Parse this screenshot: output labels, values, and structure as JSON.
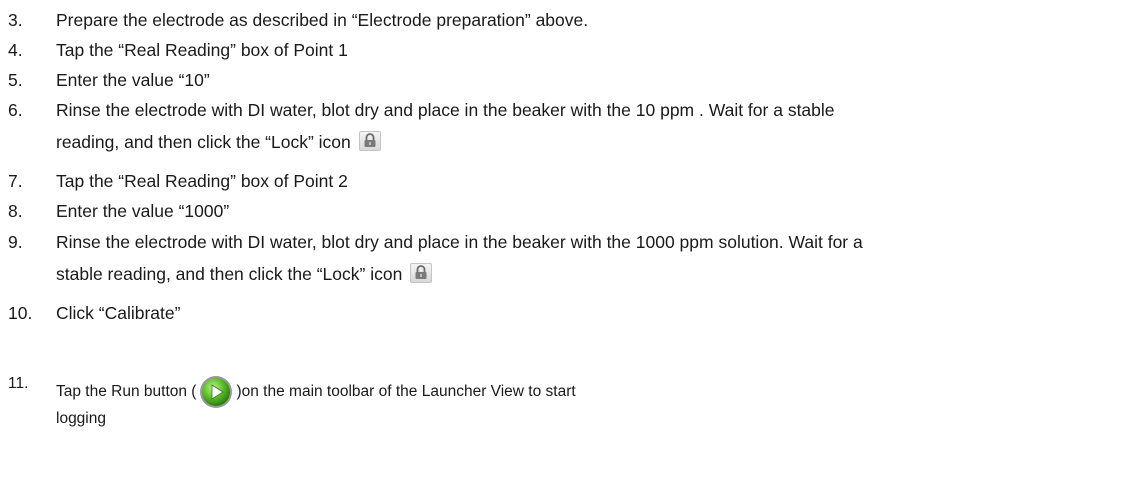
{
  "steps": [
    {
      "number": "3.",
      "text": "Prepare the electrode as described in “Electrode preparation” above."
    },
    {
      "number": "4.",
      "text": "Tap the “Real Reading” box of Point 1"
    },
    {
      "number": "5.",
      "text": "Enter the value “10”"
    },
    {
      "number": "6.",
      "text": "Rinse the electrode with DI water, blot dry and place in the beaker with the 10 ppm . Wait for a stable",
      "text_cont": "reading, and then click the “Lock” icon"
    },
    {
      "number": "7.",
      "text": "Tap the “Real Reading” box of Point 2"
    },
    {
      "number": "8.",
      "text": "Enter the value “1000”"
    },
    {
      "number": "9.",
      "text": "Rinse the electrode with DI water, blot dry and place in the beaker with the 1000 ppm solution. Wait for a",
      "text_cont": "stable reading, and then click the “Lock” icon"
    },
    {
      "number": "10.",
      "text": "Click “Calibrate”"
    },
    {
      "number": "11.",
      "text_before": "Tap the Run button (",
      "text_after": ")on the main toolbar of the Launcher View to start",
      "text_cont": "logging"
    }
  ],
  "icons": {
    "lock": "lock-icon",
    "run": "play-icon",
    "run_color": "#5cbf2a"
  }
}
